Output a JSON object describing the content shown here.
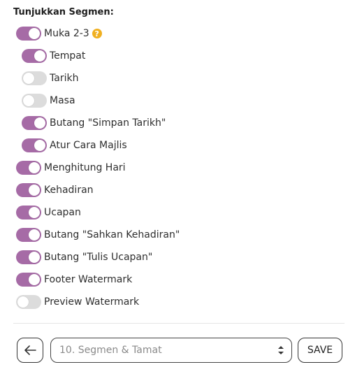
{
  "heading": "Tunjukkan Segmen:",
  "colors": {
    "accent": "#a66ba6",
    "off": "#dcdcdc",
    "help": "#f0b021"
  },
  "items": [
    {
      "label": "Muka 2-3",
      "on": true,
      "help": "?"
    },
    {
      "label": "Tempat",
      "on": true
    },
    {
      "label": "Tarikh",
      "on": false
    },
    {
      "label": "Masa",
      "on": false
    },
    {
      "label": "Butang \"Simpan Tarikh\"",
      "on": true
    },
    {
      "label": "Atur Cara Majlis",
      "on": true
    },
    {
      "label": "Menghitung Hari",
      "on": true
    },
    {
      "label": "Kehadiran",
      "on": true
    },
    {
      "label": "Ucapan",
      "on": true
    },
    {
      "label": "Butang \"Sahkan Kehadiran\"",
      "on": true
    },
    {
      "label": "Butang \"Tulis Ucapan\"",
      "on": true
    },
    {
      "label": "Footer Watermark",
      "on": true
    },
    {
      "label": "Preview Watermark",
      "on": false
    }
  ],
  "footer": {
    "back_icon": "arrow-left-icon",
    "select_value": "10. Segmen & Tamat",
    "save_label": "SAVE"
  }
}
